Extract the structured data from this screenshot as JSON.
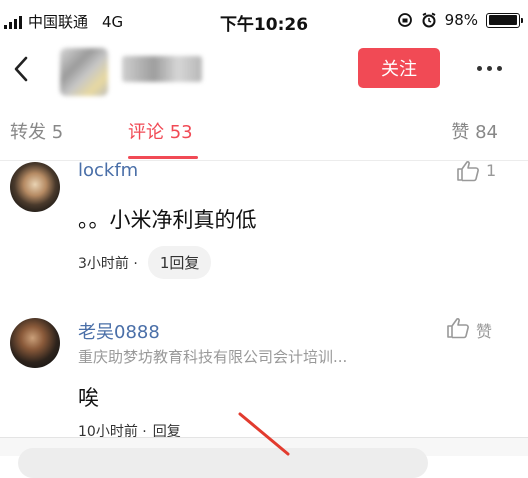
{
  "status_bar": {
    "carrier": "中国联通",
    "network": "4G",
    "time": "下午10:26",
    "battery": "98%",
    "battery_level": 0.98
  },
  "nav": {
    "follow_label": "关注"
  },
  "tabs": [
    {
      "label": "转发 5"
    },
    {
      "label": "评论 53"
    },
    {
      "label": "赞 84"
    }
  ],
  "comments": [
    {
      "username": "lockfm",
      "like_count": "1",
      "text": "。。小米净利真的低",
      "time": "3小时前 ·",
      "reply": "1回复"
    },
    {
      "username": "老吴0888",
      "like_label": "赞",
      "subtitle": "重庆助梦坊教育科技有限公司会计培训...",
      "text": "唉",
      "time": "10小时前 ·",
      "reply": "回复"
    }
  ],
  "colors": {
    "accent": "#f14a55",
    "username": "#4a6fa8"
  }
}
